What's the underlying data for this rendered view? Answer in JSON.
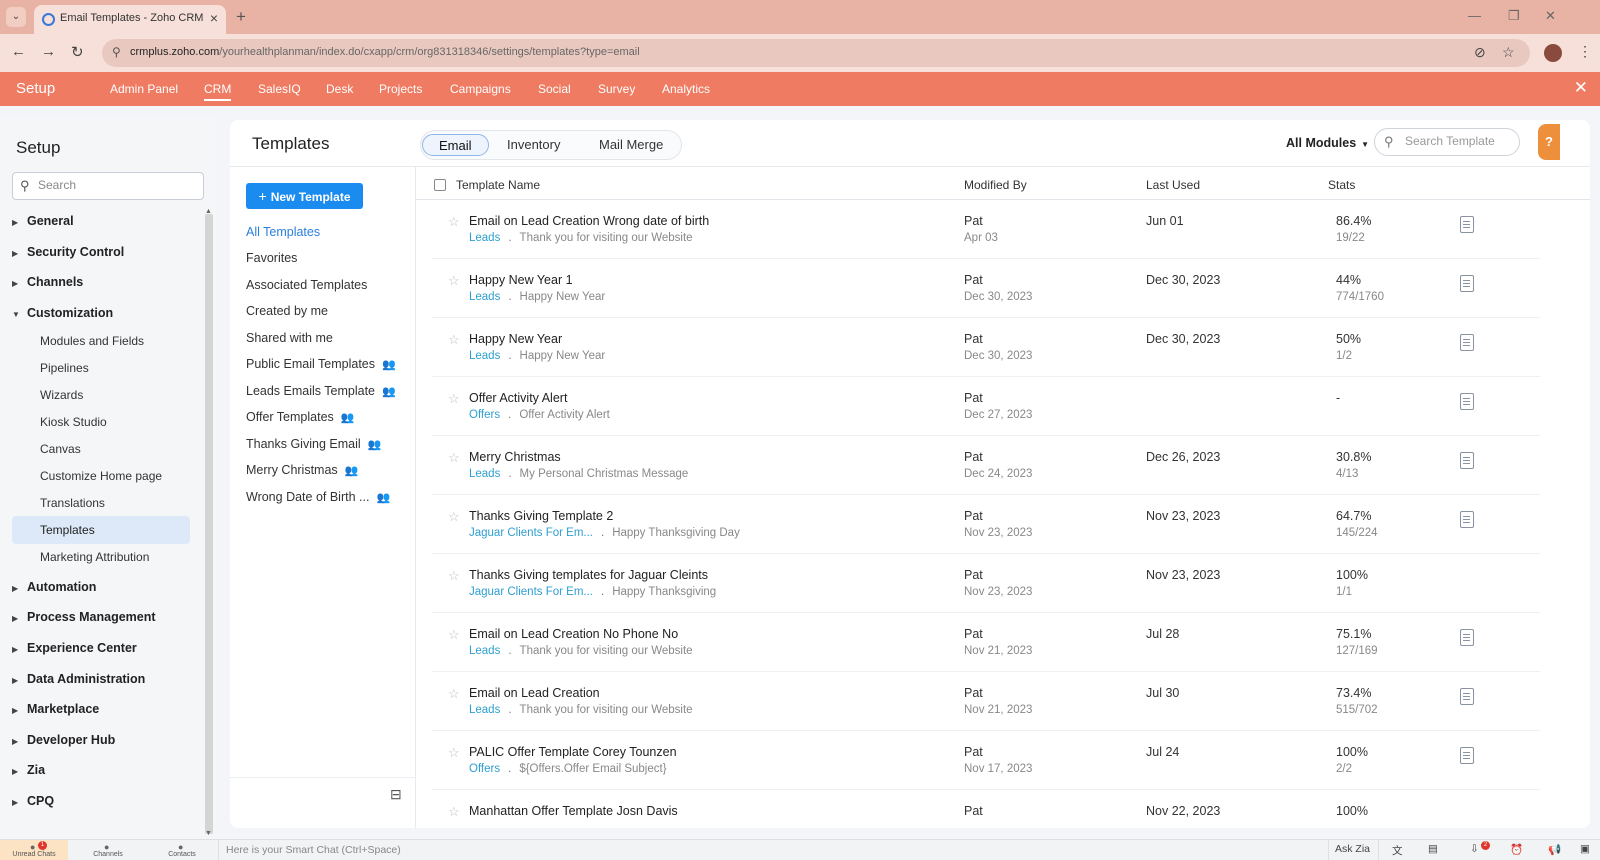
{
  "browser": {
    "tab_title": "Email Templates - Zoho CRM",
    "url_domain": "crmplus.zoho.com",
    "url_path": "/yourhealthplanman/index.do/cxapp/crm/org831318346/settings/templates?type=email"
  },
  "topnav": {
    "brand": "Setup",
    "items": [
      "Admin Panel",
      "CRM",
      "SalesIQ",
      "Desk",
      "Projects",
      "Campaigns",
      "Social",
      "Survey",
      "Analytics"
    ],
    "active": "CRM"
  },
  "setup": {
    "title": "Setup",
    "search_placeholder": "Search",
    "sections": [
      "General",
      "Security Control",
      "Channels",
      "Customization",
      "Automation",
      "Process Management",
      "Experience Center",
      "Data Administration",
      "Marketplace",
      "Developer Hub",
      "Zia",
      "CPQ"
    ],
    "customization_items": [
      "Modules and Fields",
      "Pipelines",
      "Wizards",
      "Kiosk Studio",
      "Canvas",
      "Customize Home page",
      "Translations",
      "Templates",
      "Marketing Attribution"
    ],
    "active_item": "Templates"
  },
  "main": {
    "title": "Templates",
    "type_tabs": [
      "Email",
      "Inventory",
      "Mail Merge"
    ],
    "active_type": "Email",
    "module_filter": "All Modules",
    "search_placeholder": "Search Template",
    "new_button": "New Template",
    "folders": [
      "All Templates",
      "Favorites",
      "Associated Templates",
      "Created by me",
      "Shared with me",
      "Public Email Templates",
      "Leads Emails Template",
      "Offer Templates",
      "Thanks Giving Email",
      "Merry Christmas",
      "Wrong Date of Birth ..."
    ],
    "active_folder": "All Templates",
    "columns": {
      "name": "Template Name",
      "modified_by": "Modified By",
      "last_used": "Last Used",
      "stats": "Stats"
    },
    "rows": [
      {
        "name": "Email on Lead Creation Wrong date of birth",
        "module": "Leads",
        "subject": "Thank you for visiting our Website",
        "by": "Pat",
        "date": "Apr 03",
        "used": "Jun 01",
        "pct": "86.4%",
        "count": "19/22"
      },
      {
        "name": "Happy New Year 1",
        "module": "Leads",
        "subject": "Happy New Year",
        "by": "Pat",
        "date": "Dec 30, 2023",
        "used": "Dec 30, 2023",
        "pct": "44%",
        "count": "774/1760"
      },
      {
        "name": "Happy New Year",
        "module": "Leads",
        "subject": "Happy New Year",
        "by": "Pat",
        "date": "Dec 30, 2023",
        "used": "Dec 30, 2023",
        "pct": "50%",
        "count": "1/2"
      },
      {
        "name": "Offer Activity Alert",
        "module": "Offers",
        "subject": "Offer Activity Alert",
        "by": "Pat",
        "date": "Dec 27, 2023",
        "used": "",
        "pct": "-",
        "count": ""
      },
      {
        "name": "Merry Christmas",
        "module": "Leads",
        "subject": "My Personal Christmas Message",
        "by": "Pat",
        "date": "Dec 24, 2023",
        "used": "Dec 26, 2023",
        "pct": "30.8%",
        "count": "4/13"
      },
      {
        "name": "Thanks Giving Template 2",
        "module": "Jaguar Clients For Em...",
        "subject": "Happy Thanksgiving Day",
        "by": "Pat",
        "date": "Nov 23, 2023",
        "used": "Nov 23, 2023",
        "pct": "64.7%",
        "count": "145/224"
      },
      {
        "name": "Thanks Giving templates for Jaguar Cleints",
        "module": "Jaguar Clients For Em...",
        "subject": "Happy Thanksgiving",
        "by": "Pat",
        "date": "Nov 23, 2023",
        "used": "Nov 23, 2023",
        "pct": "100%",
        "count": "1/1"
      },
      {
        "name": "Email on Lead Creation No Phone No",
        "module": "Leads",
        "subject": "Thank you for visiting our Website",
        "by": "Pat",
        "date": "Nov 21, 2023",
        "used": "Jul 28",
        "pct": "75.1%",
        "count": "127/169"
      },
      {
        "name": "Email on Lead Creation",
        "module": "Leads",
        "subject": "Thank you for visiting our Website",
        "by": "Pat",
        "date": "Nov 21, 2023",
        "used": "Jul 30",
        "pct": "73.4%",
        "count": "515/702"
      },
      {
        "name": "PALIC Offer Template Corey Tounzen",
        "module": "Offers",
        "subject": "${Offers.Offer Email Subject}",
        "by": "Pat",
        "date": "Nov 17, 2023",
        "used": "Jul 24",
        "pct": "100%",
        "count": "2/2"
      },
      {
        "name": "Manhattan Offer Template Josn Davis",
        "module": "",
        "subject": "",
        "by": "Pat",
        "date": "",
        "used": "Nov 22, 2023",
        "pct": "100%",
        "count": ""
      }
    ]
  },
  "bottombar": {
    "items": [
      "Unread Chats",
      "Channels",
      "Contacts"
    ],
    "unread_badge": "1",
    "smartchat": "Here is your Smart Chat (Ctrl+Space)",
    "ask_zia": "Ask Zia",
    "notif_badge": "2"
  }
}
